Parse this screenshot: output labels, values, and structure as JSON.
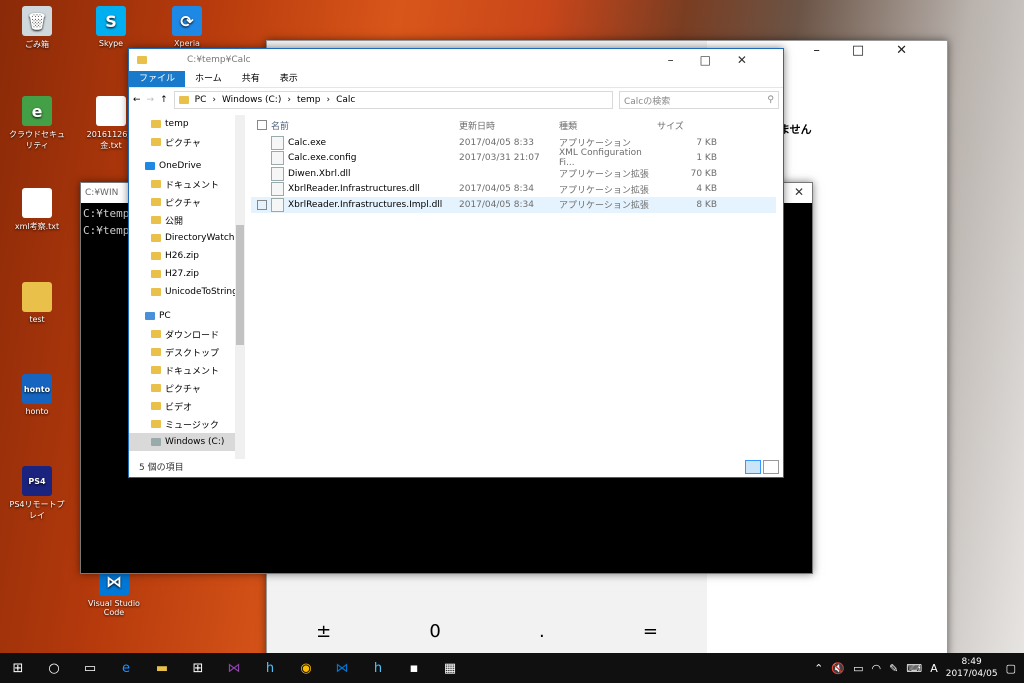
{
  "desktop": {
    "icons": [
      {
        "label": "ごみ箱",
        "glyph": "🗑",
        "color": "#cfd8dc"
      },
      {
        "label": "Skype",
        "glyph": "S",
        "color": "#00aff0"
      },
      {
        "label": "Xperia Companion",
        "glyph": "⟳",
        "color": "#1e88e5"
      },
      {
        "label": "クラウドセキュリティ",
        "glyph": "e",
        "color": "#43a047"
      },
      {
        "label": "20161126旅\n金.txt",
        "glyph": "",
        "color": "#ffffff"
      },
      {
        "label": "xml考察.txt",
        "glyph": "",
        "color": "#ffffff"
      },
      {
        "label": "test",
        "glyph": "",
        "color": "#e8c04a"
      },
      {
        "label": "honto",
        "glyph": "honto",
        "color": "#1565c0"
      },
      {
        "label": "PS4リモートプレイ",
        "glyph": "PS4",
        "color": "#1a237e"
      },
      {
        "label": "Visual Studio\nCode",
        "glyph": "⋈",
        "color": "#0078d7"
      }
    ]
  },
  "calculator": {
    "message": "ません",
    "bottom_keys": [
      "±",
      "0",
      ".",
      "="
    ]
  },
  "cmd": {
    "title": "C:¥WIN",
    "lines": [
      "C:¥temp¥C",
      "C:¥temp¥C"
    ]
  },
  "explorer": {
    "title": "C:¥temp¥Calc",
    "ribbon_tabs": [
      "ファイル",
      "ホーム",
      "共有",
      "表示"
    ],
    "breadcrumb": [
      "PC",
      "Windows (C:)",
      "temp",
      "Calc"
    ],
    "search_placeholder": "Calcの検索",
    "nav_items": [
      {
        "label": "temp",
        "type": "folder",
        "selected": false
      },
      {
        "label": "ピクチャ",
        "type": "folder",
        "selected": false
      },
      {
        "label": "OneDrive",
        "type": "cloud",
        "selected": false
      },
      {
        "label": "ドキュメント",
        "type": "folder",
        "selected": false
      },
      {
        "label": "ピクチャ",
        "type": "folder",
        "selected": false
      },
      {
        "label": "公開",
        "type": "folder",
        "selected": false
      },
      {
        "label": "DirectoryWatche",
        "type": "folder",
        "selected": false
      },
      {
        "label": "H26.zip",
        "type": "zip",
        "selected": false
      },
      {
        "label": "H27.zip",
        "type": "zip",
        "selected": false
      },
      {
        "label": "UnicodeToString",
        "type": "folder",
        "selected": false
      },
      {
        "label": "PC",
        "type": "pc",
        "selected": false
      },
      {
        "label": "ダウンロード",
        "type": "folder",
        "selected": false
      },
      {
        "label": "デスクトップ",
        "type": "folder",
        "selected": false
      },
      {
        "label": "ドキュメント",
        "type": "folder",
        "selected": false
      },
      {
        "label": "ピクチャ",
        "type": "folder",
        "selected": false
      },
      {
        "label": "ビデオ",
        "type": "folder",
        "selected": false
      },
      {
        "label": "ミュージック",
        "type": "folder",
        "selected": false
      },
      {
        "label": "Windows (C:)",
        "type": "drive",
        "selected": true
      }
    ],
    "columns": [
      "名前",
      "更新日時",
      "種類",
      "サイズ"
    ],
    "files": [
      {
        "name": "Calc.exe",
        "date": "2017/04/05 8:33",
        "type": "アプリケーション",
        "size": "7 KB",
        "selected": false
      },
      {
        "name": "Calc.exe.config",
        "date": "2017/03/31 21:07",
        "type": "XML Configuration Fi...",
        "size": "1 KB",
        "selected": false
      },
      {
        "name": "Diwen.Xbrl.dll",
        "date": "",
        "type": "アプリケーション拡張",
        "size": "70 KB",
        "selected": false
      },
      {
        "name": "XbrlReader.Infrastructures.dll",
        "date": "2017/04/05 8:34",
        "type": "アプリケーション拡張",
        "size": "4 KB",
        "selected": false
      },
      {
        "name": "XbrlReader.Infrastructures.Impl.dll",
        "date": "2017/04/05 8:34",
        "type": "アプリケーション拡張",
        "size": "8 KB",
        "selected": true
      }
    ],
    "status": "5 個の項目"
  },
  "taskbar": {
    "time": "8:49",
    "date": "2017/04/05",
    "ime": "A"
  }
}
